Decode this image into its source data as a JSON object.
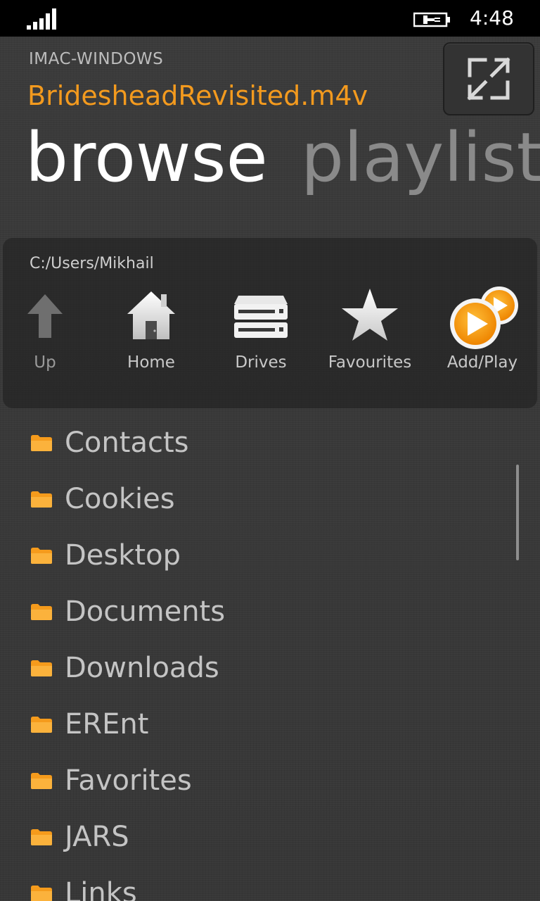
{
  "status": {
    "time": "4:48",
    "signal_icon": "signal-bars-icon",
    "battery_icon": "battery-charging-icon"
  },
  "header": {
    "server": "IMAC-WINDOWS",
    "file": "BridesheadRevisited.m4v",
    "accent": "#f39a1e"
  },
  "pivot": {
    "active": "browse",
    "inactive": "playlist"
  },
  "toolbar": {
    "path": "C:/Users/Mikhail",
    "buttons": [
      {
        "label": "Up",
        "icon": "up-arrow-icon"
      },
      {
        "label": "Home",
        "icon": "home-icon"
      },
      {
        "label": "Drives",
        "icon": "drives-icon"
      },
      {
        "label": "Favourites",
        "icon": "star-icon"
      },
      {
        "label": "Add/Play",
        "icon": "add-play-icon"
      }
    ]
  },
  "folders": [
    "Contacts",
    "Cookies",
    "Desktop",
    "Documents",
    "Downloads",
    "EREnt",
    "Favorites",
    "JARS",
    "Links"
  ]
}
